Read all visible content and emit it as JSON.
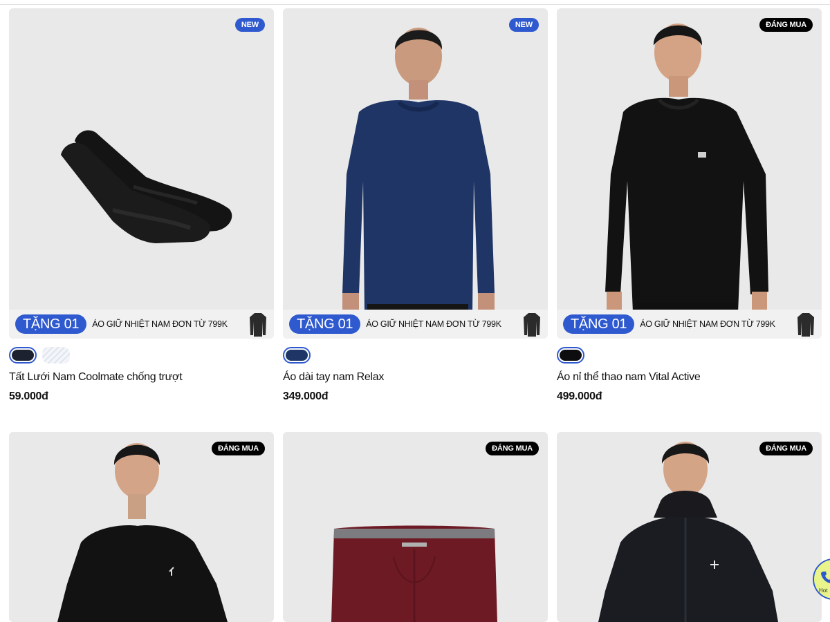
{
  "colors": {
    "accent": "#2f5acf",
    "badge_dark": "#000000",
    "image_bg": "#e9e9ea",
    "promo_bg": "#f1f1f2"
  },
  "products": [
    {
      "badge": "NEW",
      "badge_style": "new",
      "promo": {
        "pill": "TẶNG 01",
        "text": "ÁO GIỮ NHIỆT NAM ĐƠN TỪ 799K"
      },
      "name": "Tất Lưới Nam Coolmate chống trượt",
      "price": "59.000đ",
      "swatch_colors": [
        "#1c2230",
        "#eef1f6"
      ]
    },
    {
      "badge": "NEW",
      "badge_style": "new",
      "promo": {
        "pill": "TẶNG 01",
        "text": "ÁO GIỮ NHIỆT NAM ĐƠN TỪ 799K"
      },
      "name": "Áo dài tay nam Relax",
      "price": "349.000đ",
      "swatch_colors": [
        "#1f3566"
      ]
    },
    {
      "badge": "ĐÁNG MUA",
      "badge_style": "hot",
      "promo": {
        "pill": "TẶNG 01",
        "text": "ÁO GIỮ NHIỆT NAM ĐƠN TỪ 799K"
      },
      "name": "Áo nỉ thể thao nam Vital Active",
      "price": "499.000đ",
      "swatch_colors": [
        "#0d0d0f"
      ]
    },
    {
      "badge": "ĐÁNG MUA",
      "badge_style": "hot"
    },
    {
      "badge": "ĐÁNG MUA",
      "badge_style": "hot"
    },
    {
      "badge": "ĐÁNG MUA",
      "badge_style": "hot"
    }
  ],
  "hotline": {
    "label": "Hot",
    "icon": "phone-icon"
  }
}
